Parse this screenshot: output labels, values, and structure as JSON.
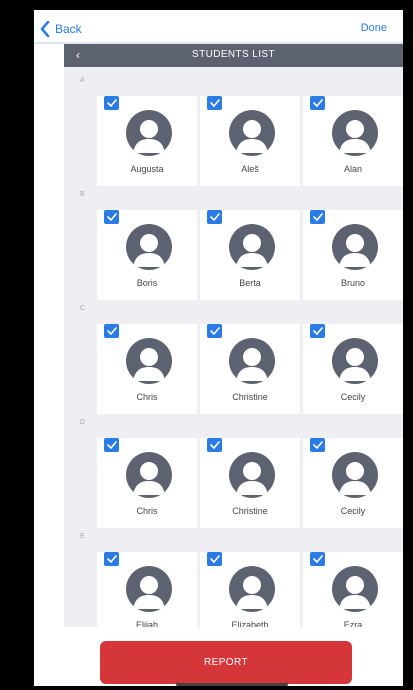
{
  "nav": {
    "back_label": "Back",
    "done_label": "Done"
  },
  "header": {
    "title": "STUDENTS LIST",
    "back_glyph": "‹"
  },
  "sections": [
    {
      "letter": "A",
      "students": [
        {
          "name": "Augusta",
          "checked": true
        },
        {
          "name": "Aleš",
          "checked": true
        },
        {
          "name": "Alan",
          "checked": true
        }
      ]
    },
    {
      "letter": "B",
      "students": [
        {
          "name": "Boris",
          "checked": true
        },
        {
          "name": "Berta",
          "checked": true
        },
        {
          "name": "Bruno",
          "checked": true
        }
      ]
    },
    {
      "letter": "C",
      "students": [
        {
          "name": "Chris",
          "checked": true
        },
        {
          "name": "Christine",
          "checked": true
        },
        {
          "name": "Cecily",
          "checked": true
        }
      ]
    },
    {
      "letter": "D",
      "students": [
        {
          "name": "Chris",
          "checked": true
        },
        {
          "name": "Christine",
          "checked": true
        },
        {
          "name": "Cecily",
          "checked": true
        }
      ]
    },
    {
      "letter": "E",
      "students": [
        {
          "name": "Elijah",
          "checked": true
        },
        {
          "name": "Elizabeth",
          "checked": true
        },
        {
          "name": "Ezra",
          "checked": true
        }
      ]
    }
  ],
  "footer": {
    "report_label": "REPORT"
  },
  "colors": {
    "accent": "#2a7be4",
    "header_bg": "#5d6270",
    "report_bg": "#d53639"
  },
  "icons": {
    "check": "checkmark-icon",
    "avatar": "user-avatar-icon",
    "back": "chevron-left-icon"
  }
}
